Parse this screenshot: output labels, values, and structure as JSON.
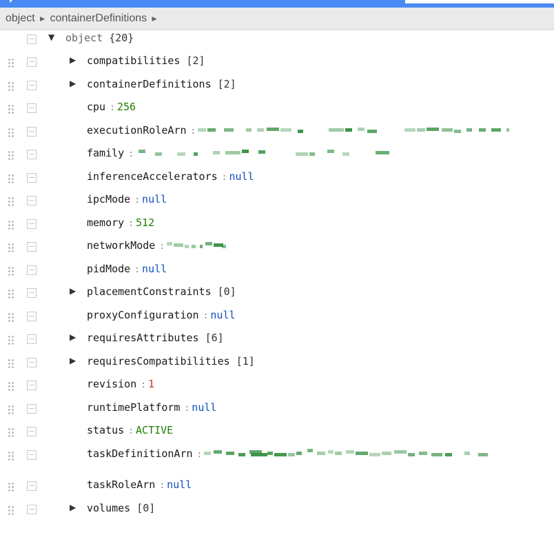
{
  "breadcrumb": {
    "items": [
      "object",
      "containerDefinitions"
    ],
    "separator": "►"
  },
  "tree": {
    "root": {
      "field": "object",
      "count": "{20}",
      "toggle": "▼"
    },
    "rows": [
      {
        "field": "compatibilities",
        "count": "[2]",
        "expandable": true
      },
      {
        "field": "containerDefinitions",
        "count": "[2]",
        "expandable": true
      },
      {
        "field": "cpu",
        "separator": ":",
        "value": "256",
        "type": "number"
      },
      {
        "field": "executionRoleArn",
        "separator": ":",
        "redacted": true
      },
      {
        "field": "family",
        "separator": ":",
        "redacted": true
      },
      {
        "field": "inferenceAccelerators",
        "separator": ":",
        "value": "null",
        "type": "null"
      },
      {
        "field": "ipcMode",
        "separator": ":",
        "value": "null",
        "type": "null"
      },
      {
        "field": "memory",
        "separator": ":",
        "value": "512",
        "type": "number"
      },
      {
        "field": "networkMode",
        "separator": ":",
        "redacted": true
      },
      {
        "field": "pidMode",
        "separator": ":",
        "value": "null",
        "type": "null"
      },
      {
        "field": "placementConstraints",
        "count": "[0]",
        "expandable": true
      },
      {
        "field": "proxyConfiguration",
        "separator": ":",
        "value": "null",
        "type": "null"
      },
      {
        "field": "requiresAttributes",
        "count": "[6]",
        "expandable": true
      },
      {
        "field": "requiresCompatibilities",
        "count": "[1]",
        "expandable": true
      },
      {
        "field": "revision",
        "separator": ":",
        "value": "1",
        "type": "red"
      },
      {
        "field": "runtimePlatform",
        "separator": ":",
        "value": "null",
        "type": "null"
      },
      {
        "field": "status",
        "separator": ":",
        "value": "ACTIVE",
        "type": "string"
      },
      {
        "field": "taskDefinitionArn",
        "separator": ":",
        "redacted": true
      },
      {
        "field": "taskRoleArn",
        "separator": ":",
        "value": "null",
        "type": "null"
      },
      {
        "field": "volumes",
        "count": "[0]",
        "expandable": true
      }
    ],
    "expand_glyph": "▶"
  },
  "colors": {
    "topbar": "#4a8af4",
    "number": "#1f8000",
    "null": "#0f4fbf",
    "string": "#1f8000",
    "revision": "#c43131",
    "redaction": "#2e8b3a"
  }
}
